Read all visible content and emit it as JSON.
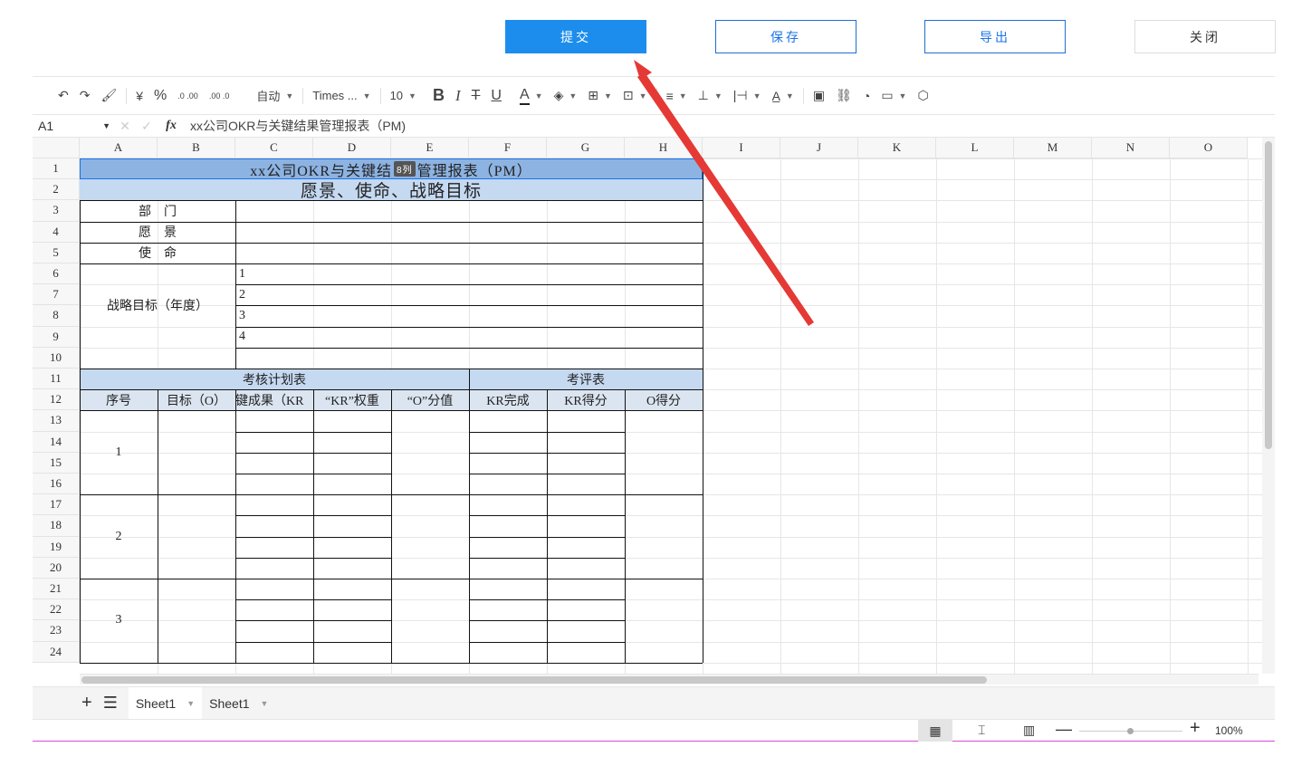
{
  "buttons": {
    "submit": "提交",
    "save": "保存",
    "export": "导出",
    "close": "关闭"
  },
  "toolbar": {
    "currency": "¥",
    "percent": "%",
    "dec_inc": ".0 .00",
    "dec_dec": ".00 .0",
    "number_format": "自动",
    "font_family": "Times ...",
    "font_size": "10",
    "bold": "B",
    "italic": "I",
    "strike": "T",
    "underline": "U",
    "font_color": "A"
  },
  "formula_bar": {
    "cell_ref": "A1",
    "fx": "fx",
    "content": "xx公司OKR与关键结果管理报表（PM)"
  },
  "grid": {
    "columns": [
      "A",
      "B",
      "C",
      "D",
      "E",
      "F",
      "G",
      "H",
      "I",
      "J",
      "K",
      "L",
      "M",
      "N",
      "O"
    ],
    "rows": [
      "1",
      "2",
      "3",
      "4",
      "5",
      "6",
      "7",
      "8",
      "9",
      "10",
      "11",
      "12",
      "13",
      "14",
      "15",
      "16",
      "17",
      "18",
      "19",
      "20",
      "21",
      "22",
      "23",
      "24"
    ],
    "title": "xx公司OKR与关键结",
    "title_tail": "管理报表（PM）",
    "row_height_tooltip": "8列",
    "subtitle": "愿景、使命、战略目标",
    "dept": "部　门",
    "vision": "愿　景",
    "mission": "使　命",
    "strategy": "战略目标（年度）",
    "goals": [
      "1",
      "2",
      "3",
      "4"
    ],
    "plan_header": "考核计划表",
    "review_header": "考评表",
    "col_headers": [
      "序号",
      "目标（O）",
      "键成果（KR",
      "“KR”权重",
      "“O”分值",
      "KR完成",
      "KR得分",
      "O得分"
    ],
    "groups": [
      "1",
      "2",
      "3"
    ]
  },
  "sheets": [
    "Sheet1",
    "Sheet1"
  ],
  "status": {
    "zoom": "100%"
  }
}
